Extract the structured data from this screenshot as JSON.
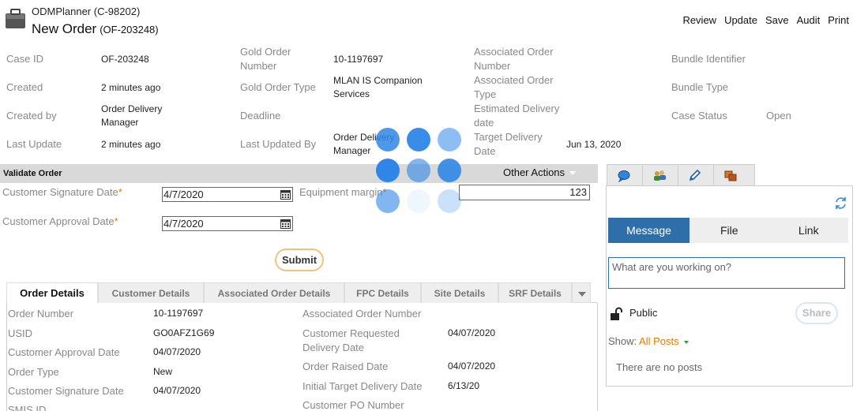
{
  "header": {
    "app_name": "ODMPlanner (C-98202)",
    "title": "New Order",
    "case_ref": "(OF-203248)",
    "actions": [
      "Review",
      "Update",
      "Save",
      "Audit",
      "Print"
    ]
  },
  "case_info": {
    "case_id": {
      "label": "Case ID",
      "value": "OF-203248"
    },
    "created": {
      "label": "Created",
      "value": "2 minutes ago"
    },
    "created_by": {
      "label": "Created by",
      "value": "Order Delivery Manager"
    },
    "last_update": {
      "label": "Last Update",
      "value": "2 minutes ago"
    },
    "gold_order_number": {
      "label": "Gold Order Number",
      "value": "10-1197697"
    },
    "gold_order_type": {
      "label": "Gold Order Type",
      "value": "MLAN IS Companion Services"
    },
    "deadline": {
      "label": "Deadline",
      "value": ""
    },
    "last_updated_by": {
      "label": "Last Updated By",
      "value": "Order Delivery Manager"
    },
    "associated_order_number": {
      "label": "Associated Order Number",
      "value": ""
    },
    "associated_order_type": {
      "label": "Associated Order Type",
      "value": ""
    },
    "estimated_delivery_date": {
      "label": "Estimated Delivery date",
      "value": ""
    },
    "target_delivery_date": {
      "label": "Target Delivery Date",
      "value": "Jun 13, 2020"
    },
    "bundle_identifier": {
      "label": "Bundle Identifier",
      "value": ""
    },
    "bundle_type": {
      "label": "Bundle Type",
      "value": ""
    },
    "case_status": {
      "label": "Case Status",
      "value": "Open"
    }
  },
  "validate": {
    "title": "Validate Order",
    "other_actions": "Other Actions",
    "customer_signature_label": "Customer Signature Date",
    "customer_signature_value": "4/7/2020",
    "customer_approval_label": "Customer Approval Date",
    "customer_approval_value": "4/7/2020",
    "equipment_margin_label": "Equipment margin",
    "equipment_margin_value": "123",
    "required_mark": "*",
    "submit": "Submit"
  },
  "detail_tabs": [
    "Order Details",
    "Customer Details",
    "Associated Order Details",
    "FPC Details",
    "Site Details",
    "SRF Details"
  ],
  "order_details": {
    "left": [
      {
        "label": "Order Number",
        "value": "10-1197697"
      },
      {
        "label": "USID",
        "value": "GO0AFZ1G69"
      },
      {
        "label": "Customer Approval Date",
        "value": "04/07/2020"
      },
      {
        "label": "Order Type",
        "value": "New"
      },
      {
        "label": "Customer Signature Date",
        "value": "04/07/2020"
      },
      {
        "label": "SMIS ID",
        "value": ""
      }
    ],
    "right": [
      {
        "label": "Associated Order Number",
        "value": ""
      },
      {
        "label": "Customer Requested Delivery Date",
        "value": "04/07/2020"
      },
      {
        "label": "Order Raised Date",
        "value": "04/07/2020"
      },
      {
        "label": "Initial Target Delivery Date",
        "value": "6/13/20"
      },
      {
        "label": "Customer PO Number",
        "value": ""
      }
    ]
  },
  "pulse": {
    "tabs": [
      "Message",
      "File",
      "Link"
    ],
    "placeholder": "What are you working on?",
    "visibility": "Public",
    "share": "Share",
    "show_label": "Show:",
    "show_filter": "All Posts",
    "empty": "There are no posts"
  },
  "colors": {
    "accent": "#2e6fa9",
    "required": "#e07b00",
    "spinner": "#2f86e8"
  }
}
